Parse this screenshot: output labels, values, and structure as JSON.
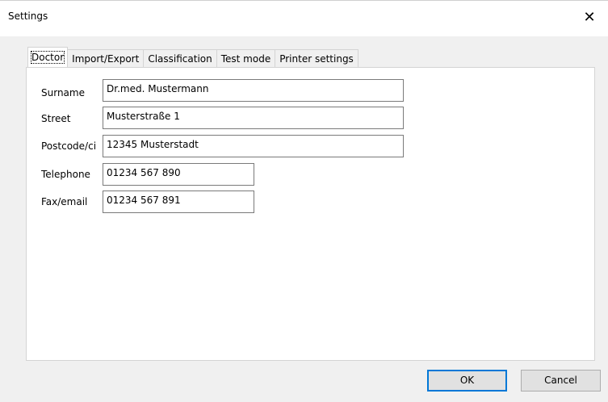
{
  "window": {
    "title": "Settings",
    "close_glyph": "✕"
  },
  "tabs": [
    {
      "label": "Doctor",
      "active": true
    },
    {
      "label": "Import/Export",
      "active": false
    },
    {
      "label": "Classification",
      "active": false
    },
    {
      "label": "Test mode",
      "active": false
    },
    {
      "label": "Printer settings",
      "active": false
    }
  ],
  "form": {
    "surname": {
      "label": "Surname",
      "value": "Dr.med. Mustermann"
    },
    "street": {
      "label": "Street",
      "value": "Musterstraße 1"
    },
    "postcode": {
      "label": "Postcode/ci",
      "value": "12345 Musterstadt"
    },
    "telephone": {
      "label": "Telephone",
      "value": "01234 567 890"
    },
    "fax": {
      "label": "Fax/email",
      "value": "01234 567 891"
    }
  },
  "buttons": {
    "ok": "OK",
    "cancel": "Cancel"
  },
  "colors": {
    "accent": "#0078d7",
    "dialog_bg": "#f0f0f0",
    "panel_bg": "#ffffff"
  }
}
